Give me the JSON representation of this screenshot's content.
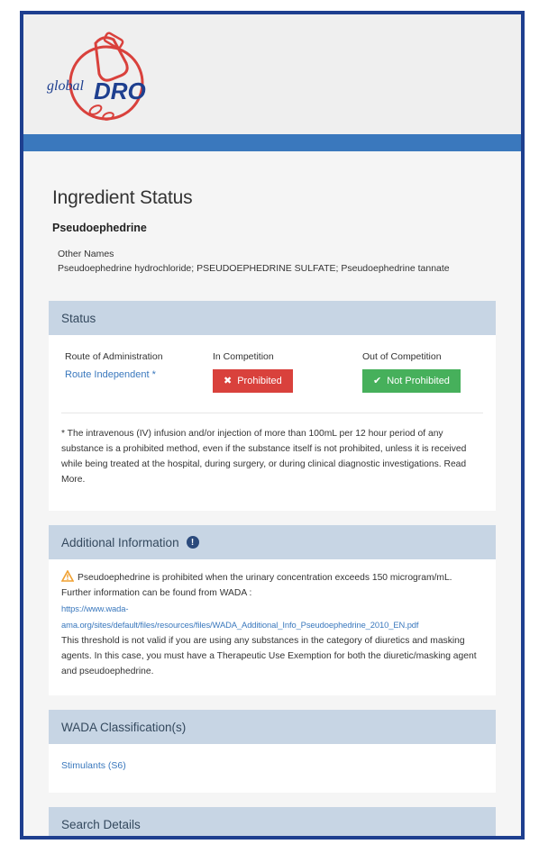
{
  "page": {
    "title": "Ingredient Status",
    "ingredient": "Pseudoephedrine",
    "other_names_label": "Other Names",
    "other_names": "Pseudoephedrine hydrochloride; PSEUDOEPHEDRINE SULFATE; Pseudoephedrine tannate"
  },
  "brand": {
    "logo_text_left": "global",
    "logo_text_right": "DRO"
  },
  "status": {
    "heading": "Status",
    "route_label": "Route of Administration",
    "route_value": "Route Independent *",
    "in_comp_label": "In Competition",
    "in_comp_value": "Prohibited",
    "out_comp_label": "Out of Competition",
    "out_comp_value": "Not Prohibited",
    "note": "* The intravenous (IV) infusion and/or injection of more than 100mL per 12 hour period of any substance is a prohibited method, even if the substance itself is not prohibited, unless it is received while being treated at the hospital, during surgery, or during clinical diagnostic investigations. Read More."
  },
  "additional": {
    "heading": "Additional Information",
    "text1": "Pseudoephedrine is prohibited when the urinary concentration exceeds 150 microgram/mL. Further information can be found from WADA :",
    "link": "https://www.wada-ama.org/sites/default/files/resources/files/WADA_Additional_Info_Pseudoephedrine_2010_EN.pdf",
    "text2": "This threshold is not valid if you are using any substances in the category of diuretics and masking agents. In this case, you must have a Therapeutic Use Exemption for both the diuretic/masking agent and pseudoephedrine."
  },
  "wada": {
    "heading": "WADA Classification(s)",
    "item": "Stimulants (S6)"
  },
  "search": {
    "heading": "Search Details"
  },
  "colors": {
    "frame": "#1e3f8f",
    "blue_bar": "#3a78bd",
    "panel_head": "#c7d5e4",
    "prohibited": "#d9413c",
    "not_prohibited": "#46b05b"
  }
}
